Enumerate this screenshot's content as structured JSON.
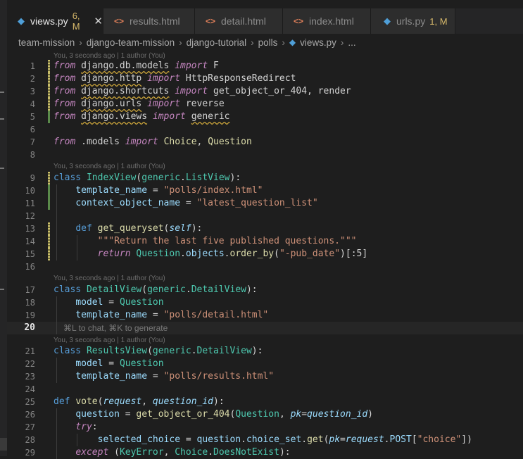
{
  "tabs": [
    {
      "label": "views.py",
      "badge": "6, M",
      "type": "py",
      "active": true,
      "close": "✕"
    },
    {
      "label": "results.html",
      "type": "html"
    },
    {
      "label": "detail.html",
      "type": "html"
    },
    {
      "label": "index.html",
      "type": "html"
    },
    {
      "label": "urls.py",
      "badge": "1, M",
      "type": "py"
    }
  ],
  "breadcrumb": [
    "team-mission",
    "django-team-mission",
    "django-tutorial",
    "polls",
    "views.py",
    "..."
  ],
  "lens": {
    "l1": "You, 3 seconds ago | 1 author (You)",
    "l2": "You, 3 seconds ago | 1 author (You)",
    "l3": "You, 3 seconds ago | 1 author (You)",
    "l4": "You, 3 seconds ago | 1 author (You)"
  },
  "hint": "⌘L to chat, ⌘K to generate",
  "line_numbers": [
    "1",
    "2",
    "3",
    "4",
    "5",
    "6",
    "7",
    "8",
    "9",
    "10",
    "11",
    "12",
    "13",
    "14",
    "15",
    "16",
    "17",
    "18",
    "19",
    "20",
    "21",
    "22",
    "23",
    "24",
    "25",
    "26",
    "27",
    "28",
    "29"
  ],
  "code": {
    "from": "from",
    "import": "import",
    "class": "class",
    "def": "def",
    "return": "return",
    "try": "try",
    "except": "except",
    "l1a": "django.db.models",
    "l1b": "F",
    "l2a": "django.http",
    "l2b": "HttpResponseRedirect",
    "l3a": "django.shortcuts",
    "l3b": "get_object_or_404",
    ", render": ", render",
    "l4a": "django.urls",
    "l4b": "reverse",
    "l5a": "django.views",
    "l5b": "generic",
    "l7a": ".models",
    "l7b": "Choice",
    "l7c": "Question",
    "IndexView": "IndexView",
    "generic": "generic",
    "ListView": "ListView",
    "DetailView": "DetailView",
    "ResultsView": "ResultsView",
    "template_name": "template_name",
    "context_object_name": "context_object_name",
    "model": "model",
    "s_index": "\"polls/index.html\"",
    "s_latest": "\"latest_question_list\"",
    "s_detail": "\"polls/detail.html\"",
    "s_results": "\"polls/results.html\"",
    "get_queryset": "get_queryset",
    "self": "self",
    "doc": "\"\"\"Return the last five published questions.\"\"\"",
    "Question": "Question",
    "objects": "objects",
    "order_by": "order_by",
    "s_pub": "\"-pub_date\"",
    "slice": ":5",
    "vote": "vote",
    "request": "request",
    "question_id": "question_id",
    "question": "question",
    "get404": "get_object_or_404",
    "pk": "pk",
    "selected_choice": "selected_choice",
    "choice_set": "choice_set",
    "get": "get",
    "POST": "POST",
    "s_choice": "\"choice\"",
    "KeyError": "KeyError",
    "Choice": "Choice",
    "DoesNotExist": "DoesNotExist"
  },
  "colors": {
    "keyword": "#c586c0",
    "function": "#dcdcaa",
    "class": "#4ec9b0",
    "string": "#ce9178",
    "variable": "#9cdcfe",
    "accent": "#4f9fd8",
    "modified": "#d7b96b"
  }
}
